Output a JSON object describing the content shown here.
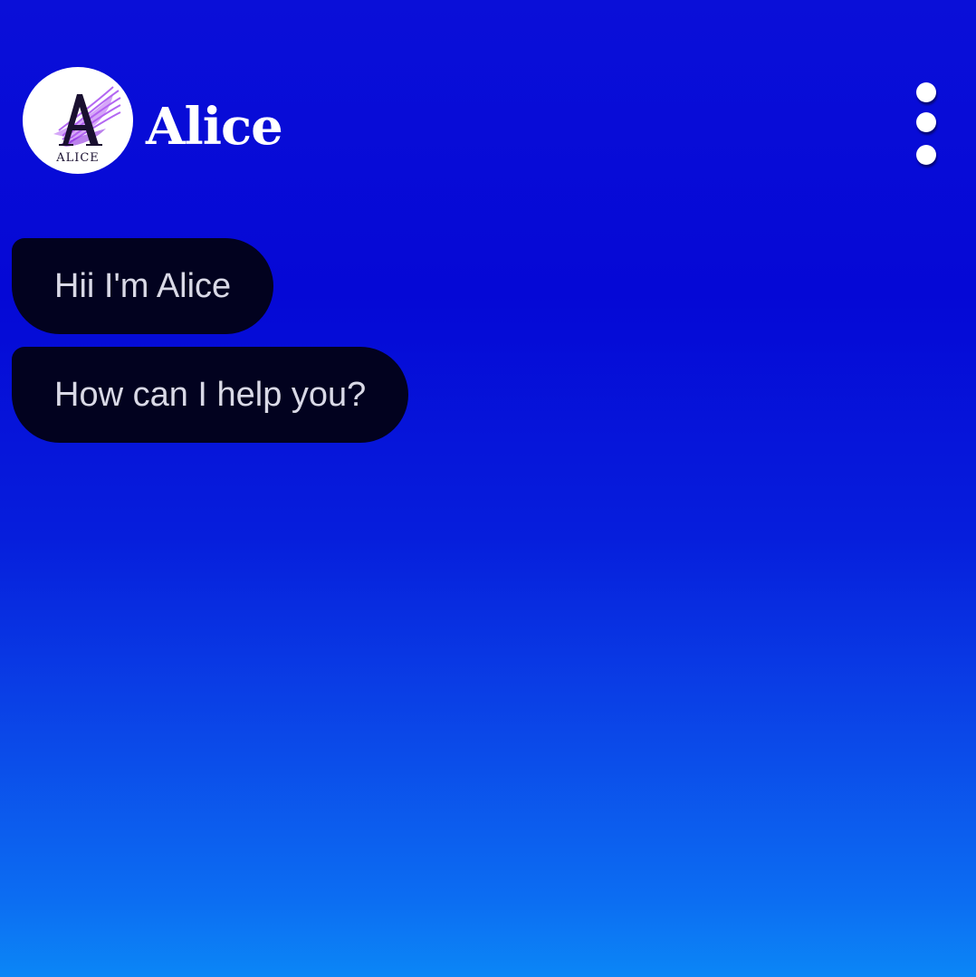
{
  "header": {
    "app_name": "Alice",
    "avatar_logo_letter": "A",
    "avatar_logo_text": "ALICE",
    "menu_icon": "more-vert-icon"
  },
  "messages": [
    {
      "text": "Hii I'm Alice",
      "sender": "bot"
    },
    {
      "text": "How can I help you?",
      "sender": "bot"
    }
  ],
  "colors": {
    "background_top": "#0508d6",
    "background_bottom": "#0b86f6",
    "bubble": "#02021f",
    "bubble_text": "#d9d9e6",
    "logo_accent": "#a64df0"
  }
}
